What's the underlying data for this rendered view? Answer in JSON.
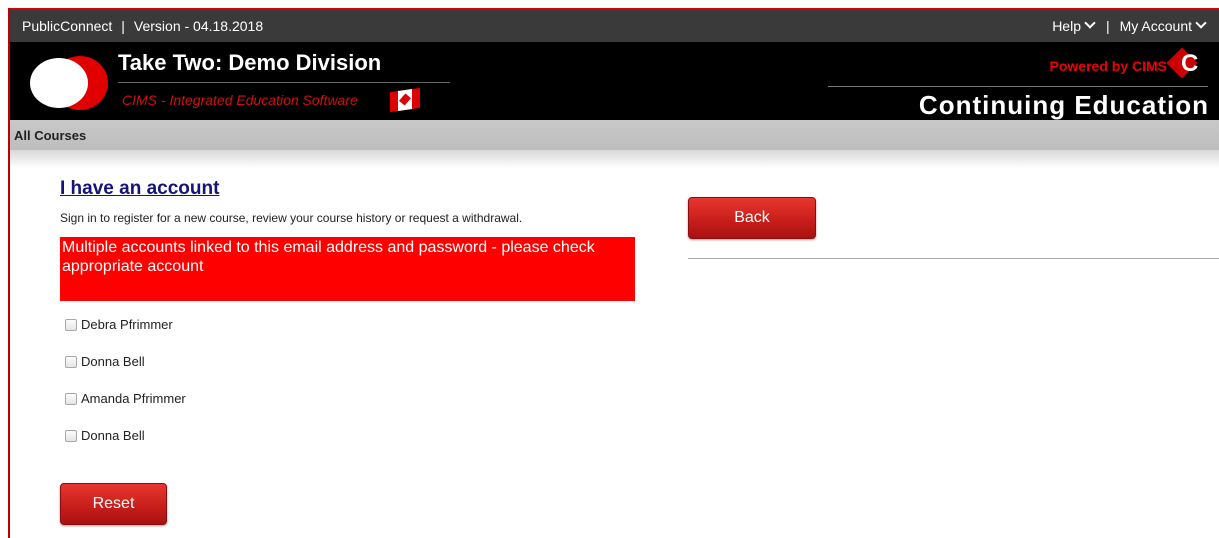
{
  "topbar": {
    "app_name": "PublicConnect",
    "separator": "|",
    "version": "Version - 04.18.2018",
    "help_label": "Help",
    "account_separator": "|",
    "account_label": "My Account"
  },
  "header": {
    "title": "Take Two: Demo Division",
    "subtitle": "CIMS - Integrated Education Software",
    "powered_by": "Powered by CIMS",
    "banner": "Continuing Education"
  },
  "nav": {
    "all_courses": "All Courses"
  },
  "login": {
    "heading": "I have an account",
    "intro": "Sign in to register for a new course, review your course history or request a withdrawal.",
    "alert": "Multiple accounts linked to this email address and password - please check appropriate account",
    "accounts": [
      {
        "name": "Debra Pfrimmer",
        "checked": false
      },
      {
        "name": "Donna Bell",
        "checked": false
      },
      {
        "name": "Amanda Pfrimmer",
        "checked": false
      },
      {
        "name": "Donna Bell",
        "checked": false
      }
    ],
    "reset_label": "Reset"
  },
  "side": {
    "back_label": "Back"
  },
  "colors": {
    "accent_red": "#ff0000",
    "button_red": "#c51d1a",
    "heading_blue": "#14147a",
    "header_black": "#000000"
  }
}
